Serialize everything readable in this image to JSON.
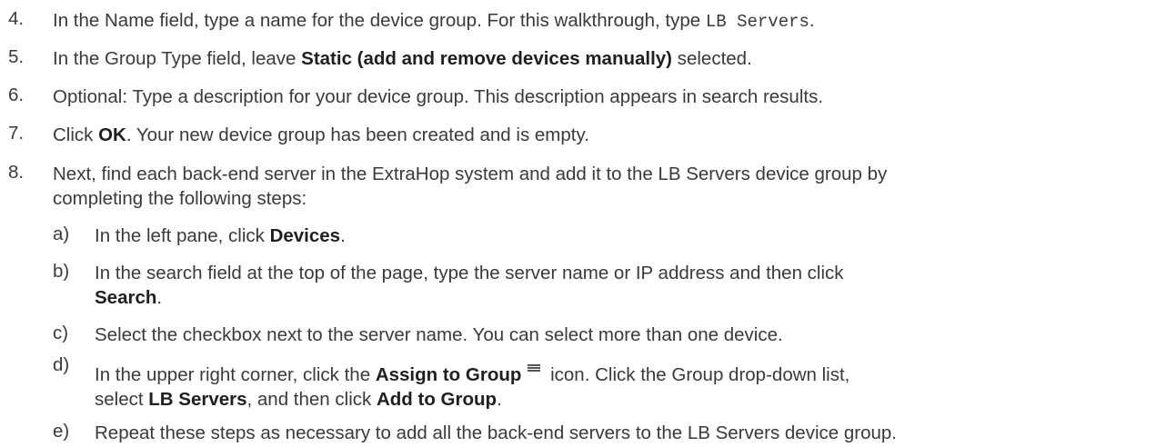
{
  "steps": [
    {
      "num": "4.",
      "t1": "In the Name field, type a name for the device group. For this walkthrough, type ",
      "code": "LB Servers",
      "t2": "."
    },
    {
      "num": "5.",
      "t1": "In the Group Type field, leave ",
      "b1": "Static (add and remove devices manually)",
      "t2": " selected."
    },
    {
      "num": "6.",
      "t1": "Optional: Type a description for your device group. This description appears in search results."
    },
    {
      "num": "7.",
      "t1": "Click ",
      "b1": "OK",
      "t2": ". Your new device group has been created and is empty."
    },
    {
      "num": "8.",
      "l1": "Next, find each back-end server in the ExtraHop system and add it to the LB Servers device group by",
      "l2": "completing the following steps:"
    }
  ],
  "substeps": [
    {
      "let": "a)",
      "t1": "In the left pane, click ",
      "b1": "Devices",
      "t2": "."
    },
    {
      "let": "b)",
      "l1": "In the search field at the top of the page, type the server name or IP address and then click",
      "b1": "Search",
      "t2": "."
    },
    {
      "let": "c)",
      "t1": "Select the checkbox next to the server name. You can select more than one device."
    },
    {
      "let": "d)",
      "t1": "In the upper right corner, click the ",
      "b1": "Assign to Group",
      "icon": "list-icon",
      "t2": " icon. Click the Group drop-down list,",
      "t3": "select ",
      "b2": "LB Servers",
      "t4": ", and then click ",
      "b3": "Add to Group",
      "t5": "."
    },
    {
      "let": "e)",
      "t1": "Repeat these steps as necessary to add all the back-end servers to the LB Servers device group."
    }
  ]
}
